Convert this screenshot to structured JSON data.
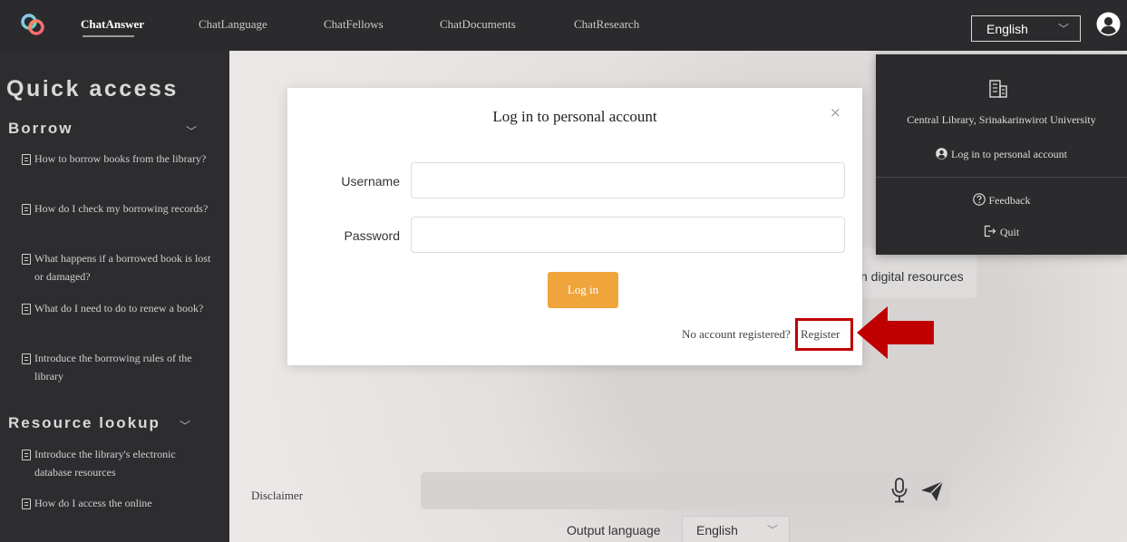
{
  "nav": {
    "items": [
      "ChatAnswer",
      "ChatLanguage",
      "ChatFellows",
      "ChatDocuments",
      "ChatResearch"
    ],
    "active": "ChatAnswer",
    "language": "English"
  },
  "sidebar": {
    "title": "Quick access",
    "sections": [
      {
        "label": "Borrow",
        "items": [
          "How to borrow books from the library?",
          "How do I check my borrowing records?",
          "What happens if a borrowed book is lost or damaged?",
          "What do I need to do to renew a book?",
          "Introduce the borrowing rules of the library"
        ]
      },
      {
        "label": "Resource lookup",
        "items": [
          "Introduce the library's electronic database resources",
          "How do I access the online"
        ]
      }
    ]
  },
  "main": {
    "chip_text": "n digital resources",
    "disclaimer": "Disclaimer",
    "output_language_label": "Output language",
    "output_language_value": "English"
  },
  "modal": {
    "title": "Log in to personal account",
    "close": "×",
    "username_label": "Username",
    "password_label": "Password",
    "username_value": "",
    "password_value": "",
    "login_button": "Log in",
    "no_account": "No account registered?",
    "register": "Register"
  },
  "dropdown": {
    "library": "Central Library, Srinakarinwirot University",
    "login": "Log in to personal account",
    "feedback": "Feedback",
    "quit": "Quit"
  },
  "colors": {
    "topbar": "#2b2b2d",
    "sidebar": "#2d2d30",
    "accent_button": "#f0a43c",
    "annotation_red": "#c00000"
  },
  "icons": [
    "logo-icon",
    "chevron-down-icon",
    "user-circle-icon",
    "document-icon",
    "close-icon",
    "microphone-icon",
    "send-icon",
    "building-icon",
    "help-circle-icon",
    "logout-icon",
    "arrow-left-icon"
  ]
}
